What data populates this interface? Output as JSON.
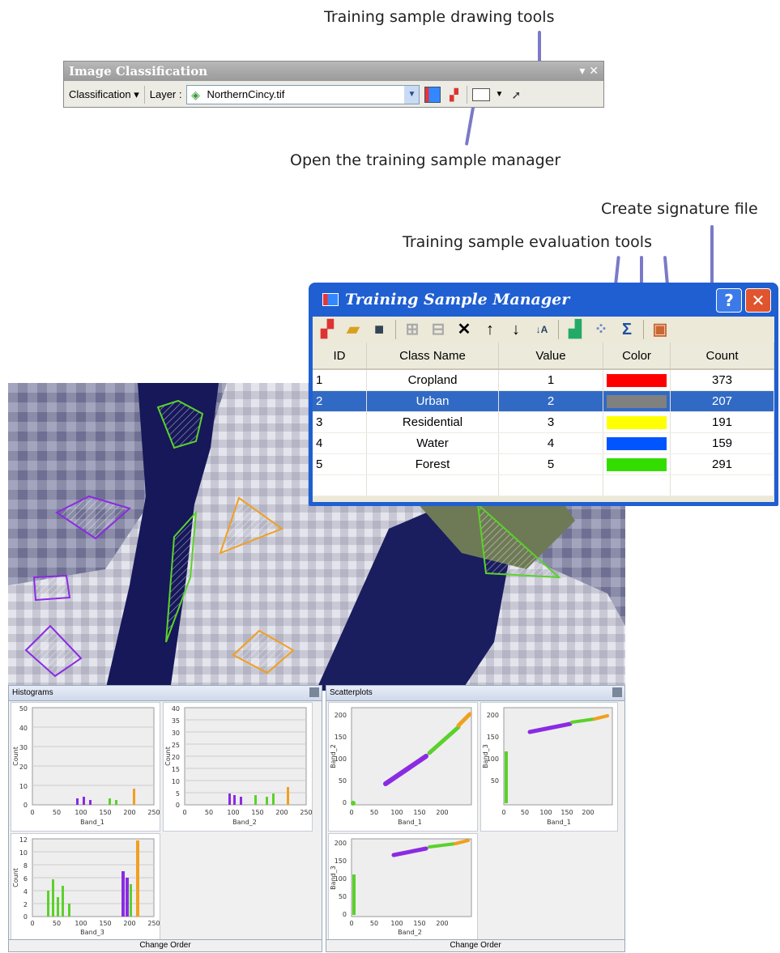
{
  "annotations": {
    "drawing_tools": "Training sample drawing tools",
    "open_manager": "Open the training sample manager",
    "signature_file": "Create signature file",
    "evaluation_tools": "Training sample evaluation tools"
  },
  "toolbar": {
    "title": "Image Classification",
    "title_controls": "▾ ✕",
    "classification_label": "Classification ▾",
    "layer_label": "Layer :",
    "layer_value": "NorthernCincy.tif"
  },
  "manager": {
    "title": "Training Sample Manager",
    "help": "?",
    "close": "✕",
    "columns": [
      "ID",
      "Class Name",
      "Value",
      "Color",
      "Count"
    ],
    "rows": [
      {
        "id": "1",
        "name": "Cropland",
        "value": "1",
        "color": "#ff0000",
        "count": "373"
      },
      {
        "id": "2",
        "name": "Urban",
        "value": "2",
        "color": "#808080",
        "count": "207"
      },
      {
        "id": "3",
        "name": "Residential",
        "value": "3",
        "color": "#ffff00",
        "count": "191"
      },
      {
        "id": "4",
        "name": "Water",
        "value": "4",
        "color": "#0055ff",
        "count": "159"
      },
      {
        "id": "5",
        "name": "Forest",
        "value": "5",
        "color": "#33dd00",
        "count": "291"
      }
    ],
    "selected_row": 1
  },
  "histograms": {
    "title": "Histograms",
    "footer": "Change Order",
    "ylabel": "Count",
    "plots": [
      {
        "xlabel": "Band_1",
        "yticks": [
          "50",
          "40",
          "30",
          "20",
          "10",
          "0"
        ],
        "xticks": [
          "0",
          "50",
          "100",
          "150",
          "200",
          "250"
        ]
      },
      {
        "xlabel": "Band_2",
        "yticks": [
          "40",
          "35",
          "30",
          "25",
          "20",
          "15",
          "10",
          "5",
          "0"
        ],
        "xticks": [
          "0",
          "50",
          "100",
          "150",
          "200",
          "250"
        ]
      },
      {
        "xlabel": "Band_3",
        "yticks": [
          "12",
          "10",
          "8",
          "6",
          "4",
          "2",
          "0"
        ],
        "xticks": [
          "0",
          "50",
          "100",
          "150",
          "200",
          "250"
        ]
      }
    ]
  },
  "scatterplots": {
    "title": "Scatterplots",
    "footer": "Change Order",
    "plots": [
      {
        "xlabel": "Band_1",
        "ylabel": "Band_2",
        "yticks": [
          "200",
          "150",
          "100",
          "50",
          "0"
        ],
        "xticks": [
          "0",
          "50",
          "100",
          "150",
          "200"
        ]
      },
      {
        "xlabel": "Band_1",
        "ylabel": "Band_3",
        "yticks": [
          "200",
          "150",
          "100",
          "50"
        ],
        "xticks": [
          "0",
          "50",
          "100",
          "150",
          "200"
        ]
      },
      {
        "xlabel": "Band_2",
        "ylabel": "Band_3",
        "yticks": [
          "200",
          "150",
          "100",
          "50",
          "0"
        ],
        "xticks": [
          "0",
          "50",
          "100",
          "150",
          "200"
        ]
      }
    ]
  },
  "colors": {
    "purple": "#8a2be2",
    "green": "#5bd12b",
    "orange": "#f0a020",
    "titlebar": "#1f5fd1"
  }
}
